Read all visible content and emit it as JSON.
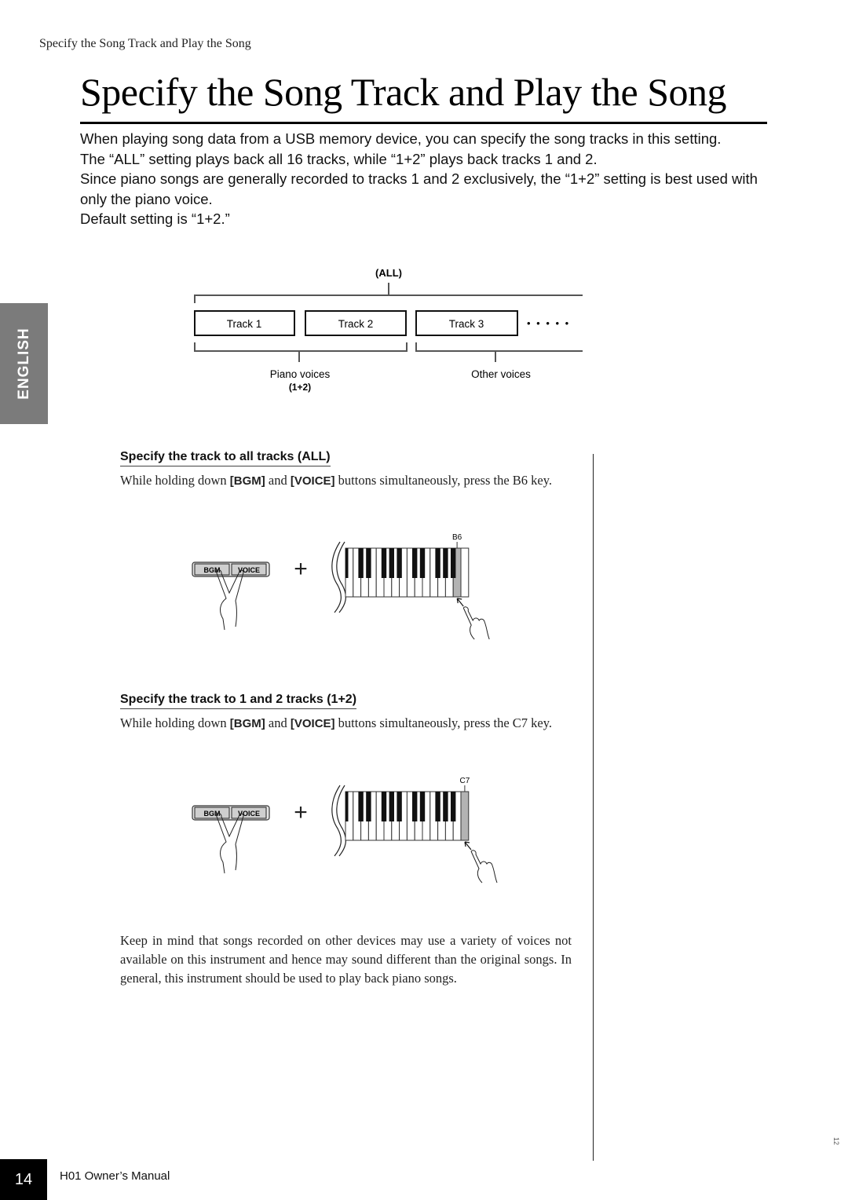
{
  "running_head": "Specify the Song Track and Play the Song",
  "title": "Specify the Song Track and Play the Song",
  "intro": [
    "When playing song data from a USB memory device, you can specify the song tracks in this setting.",
    "The “ALL” setting plays back all 16 tracks, while “1+2” plays back tracks 1 and 2.",
    "Since piano songs are generally recorded to tracks 1 and 2 exclusively, the “1+2” setting is best used with only the piano voice.",
    "Default setting is “1+2.”"
  ],
  "language_tab": "ENGLISH",
  "track_diagram": {
    "all_label": "(ALL)",
    "tracks": [
      "Track 1",
      "Track 2",
      "Track 3"
    ],
    "more_indicator": "• • • • •",
    "piano_voices_label": "Piano voices",
    "piano_setting_label": "(1+2)",
    "other_voices_label": "Other voices"
  },
  "sections": [
    {
      "heading": "Specify the track to all tracks (ALL)",
      "body_pre": "While holding down ",
      "button1": "[BGM]",
      "body_mid": " and ",
      "button2": "[VOICE]",
      "body_post": " buttons simultaneously, press the B6 key.",
      "illustration": {
        "buttons": [
          "BGM",
          "VOICE"
        ],
        "plus": "+",
        "key_label": "B6",
        "highlighted_white_key_from_right": 2
      }
    },
    {
      "heading": "Specify the track to 1 and 2 tracks (1+2)",
      "body_pre": "While holding down ",
      "button1": "[BGM]",
      "body_mid": " and ",
      "button2": "[VOICE]",
      "body_post": " buttons simultaneously, press the C7 key.",
      "illustration": {
        "buttons": [
          "BGM",
          "VOICE"
        ],
        "plus": "+",
        "key_label": "C7",
        "highlighted_white_key_from_right": 1
      }
    }
  ],
  "note": "Keep in mind that songs recorded on other devices may use a variety of voices not available on this instrument and hence may sound different than the original songs. In general, this instrument should be used to play back piano songs.",
  "footer": {
    "page_number": "14",
    "manual_title": "H01 Owner’s Manual",
    "sheet_number": "12"
  },
  "colors": {
    "tab_gray": "#7b7b7b",
    "key_highlight": "#b3b3b3",
    "button_fill": "#cfcfcf"
  }
}
